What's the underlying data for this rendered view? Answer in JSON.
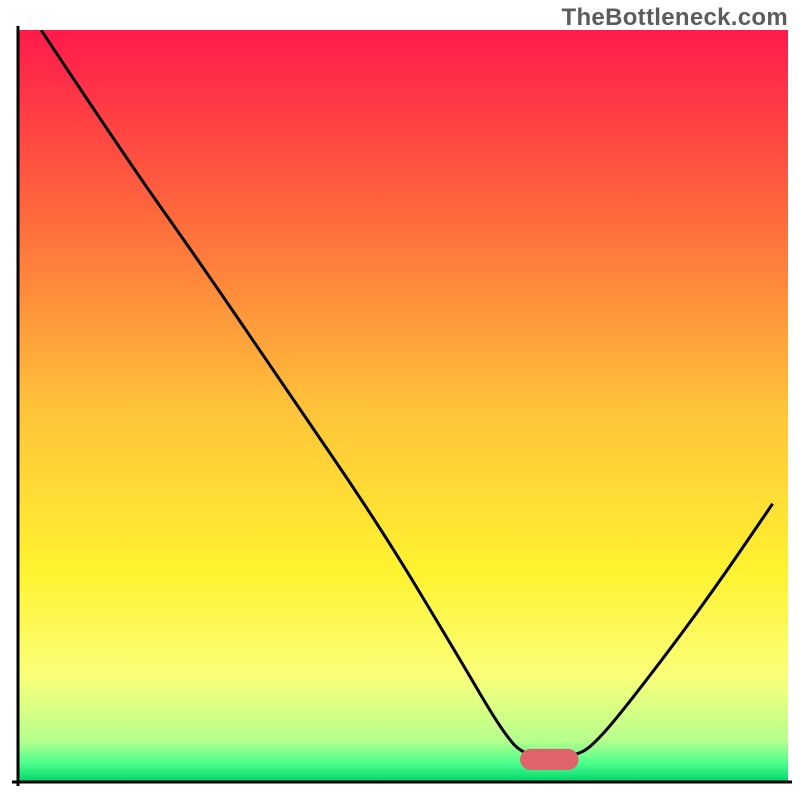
{
  "watermark": "TheBottleneck.com",
  "chart_data": {
    "type": "line",
    "title": "",
    "xlabel": "",
    "ylabel": "",
    "xlim": [
      0,
      100
    ],
    "ylim": [
      0,
      100
    ],
    "grid": false,
    "legend": false,
    "gradient_stops": [
      {
        "offset": 0.0,
        "color": "#ff1a4b"
      },
      {
        "offset": 0.25,
        "color": "#ff6a3c"
      },
      {
        "offset": 0.5,
        "color": "#ffc23a"
      },
      {
        "offset": 0.72,
        "color": "#fff330"
      },
      {
        "offset": 0.86,
        "color": "#faff7a"
      },
      {
        "offset": 0.945,
        "color": "#b6ff8d"
      },
      {
        "offset": 0.975,
        "color": "#4cff8d"
      },
      {
        "offset": 1.0,
        "color": "#00d46a"
      }
    ],
    "curve": {
      "comment": "x,y in chart-space (0..100, y=0 at bottom, y=100 at top)",
      "points": [
        {
          "x": 3.0,
          "y": 100.0
        },
        {
          "x": 14.0,
          "y": 83.0
        },
        {
          "x": 23.0,
          "y": 70.0
        },
        {
          "x": 35.0,
          "y": 52.0
        },
        {
          "x": 47.0,
          "y": 34.0
        },
        {
          "x": 57.0,
          "y": 17.0
        },
        {
          "x": 63.0,
          "y": 6.5
        },
        {
          "x": 66.0,
          "y": 3.3
        },
        {
          "x": 72.0,
          "y": 3.3
        },
        {
          "x": 75.0,
          "y": 5.0
        },
        {
          "x": 82.0,
          "y": 14.0
        },
        {
          "x": 90.0,
          "y": 25.0
        },
        {
          "x": 98.0,
          "y": 37.0
        }
      ]
    },
    "marker": {
      "x": 69.0,
      "y": 3.0,
      "rx": 3.8,
      "ry": 1.4,
      "color": "#e0636b"
    },
    "axis_color": "#000000",
    "axis_width": 3
  }
}
